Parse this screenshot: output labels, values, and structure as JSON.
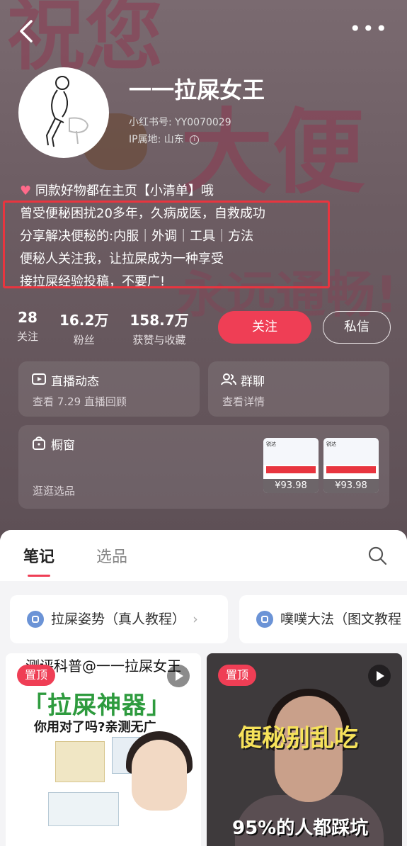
{
  "profile": {
    "name": "一一拉屎女王",
    "xhs_id_label": "小红书号:",
    "xhs_id": "YY0070029",
    "ip_label": "IP属地:",
    "ip_location": "山东",
    "bio_lines": [
      "同款好物都在主页【小清单】哦",
      "曾受便秘困扰20多年，久病成医，自救成功",
      "分享解决便秘的:内服｜外调｜工具｜方法",
      "便秘人关注我，让拉屎成为一种享受",
      "接拉屎经验投稿，不要广!"
    ],
    "background_words": [
      "祝您",
      "大便",
      "永远通畅!"
    ]
  },
  "stats": [
    {
      "value": "28",
      "label": "关注"
    },
    {
      "value": "16.2万",
      "label": "粉丝"
    },
    {
      "value": "158.7万",
      "label": "获赞与收藏"
    }
  ],
  "actions": {
    "follow": "关注",
    "message": "私信"
  },
  "cards": {
    "live": {
      "title": "直播动态",
      "subtitle": "查看 7.29 直播回顾"
    },
    "group": {
      "title": "群聊",
      "subtitle": "查看详情"
    },
    "shop": {
      "title": "橱窗",
      "subtitle": "逛逛选品",
      "products": [
        {
          "brand": "锐达",
          "price": "¥93.98"
        },
        {
          "brand": "锐达",
          "price": "¥93.98"
        }
      ]
    }
  },
  "tabs": {
    "notes": "笔记",
    "picks": "选品"
  },
  "collections": [
    {
      "label": "拉屎姿势（真人教程）"
    },
    {
      "label": "噗噗大法（图文教程"
    }
  ],
  "posts": [
    {
      "pin": "置顶",
      "top_text": "测评科普@一一拉屎女王",
      "headline": "「拉屎神器」",
      "subline": "你用对了吗?亲测无广"
    },
    {
      "pin": "置顶",
      "headline": "便秘别乱吃",
      "bottom_text": "95%的人都踩坑"
    }
  ],
  "colors": {
    "accent": "#ef3e55",
    "highlight_box": "#e8353f"
  }
}
